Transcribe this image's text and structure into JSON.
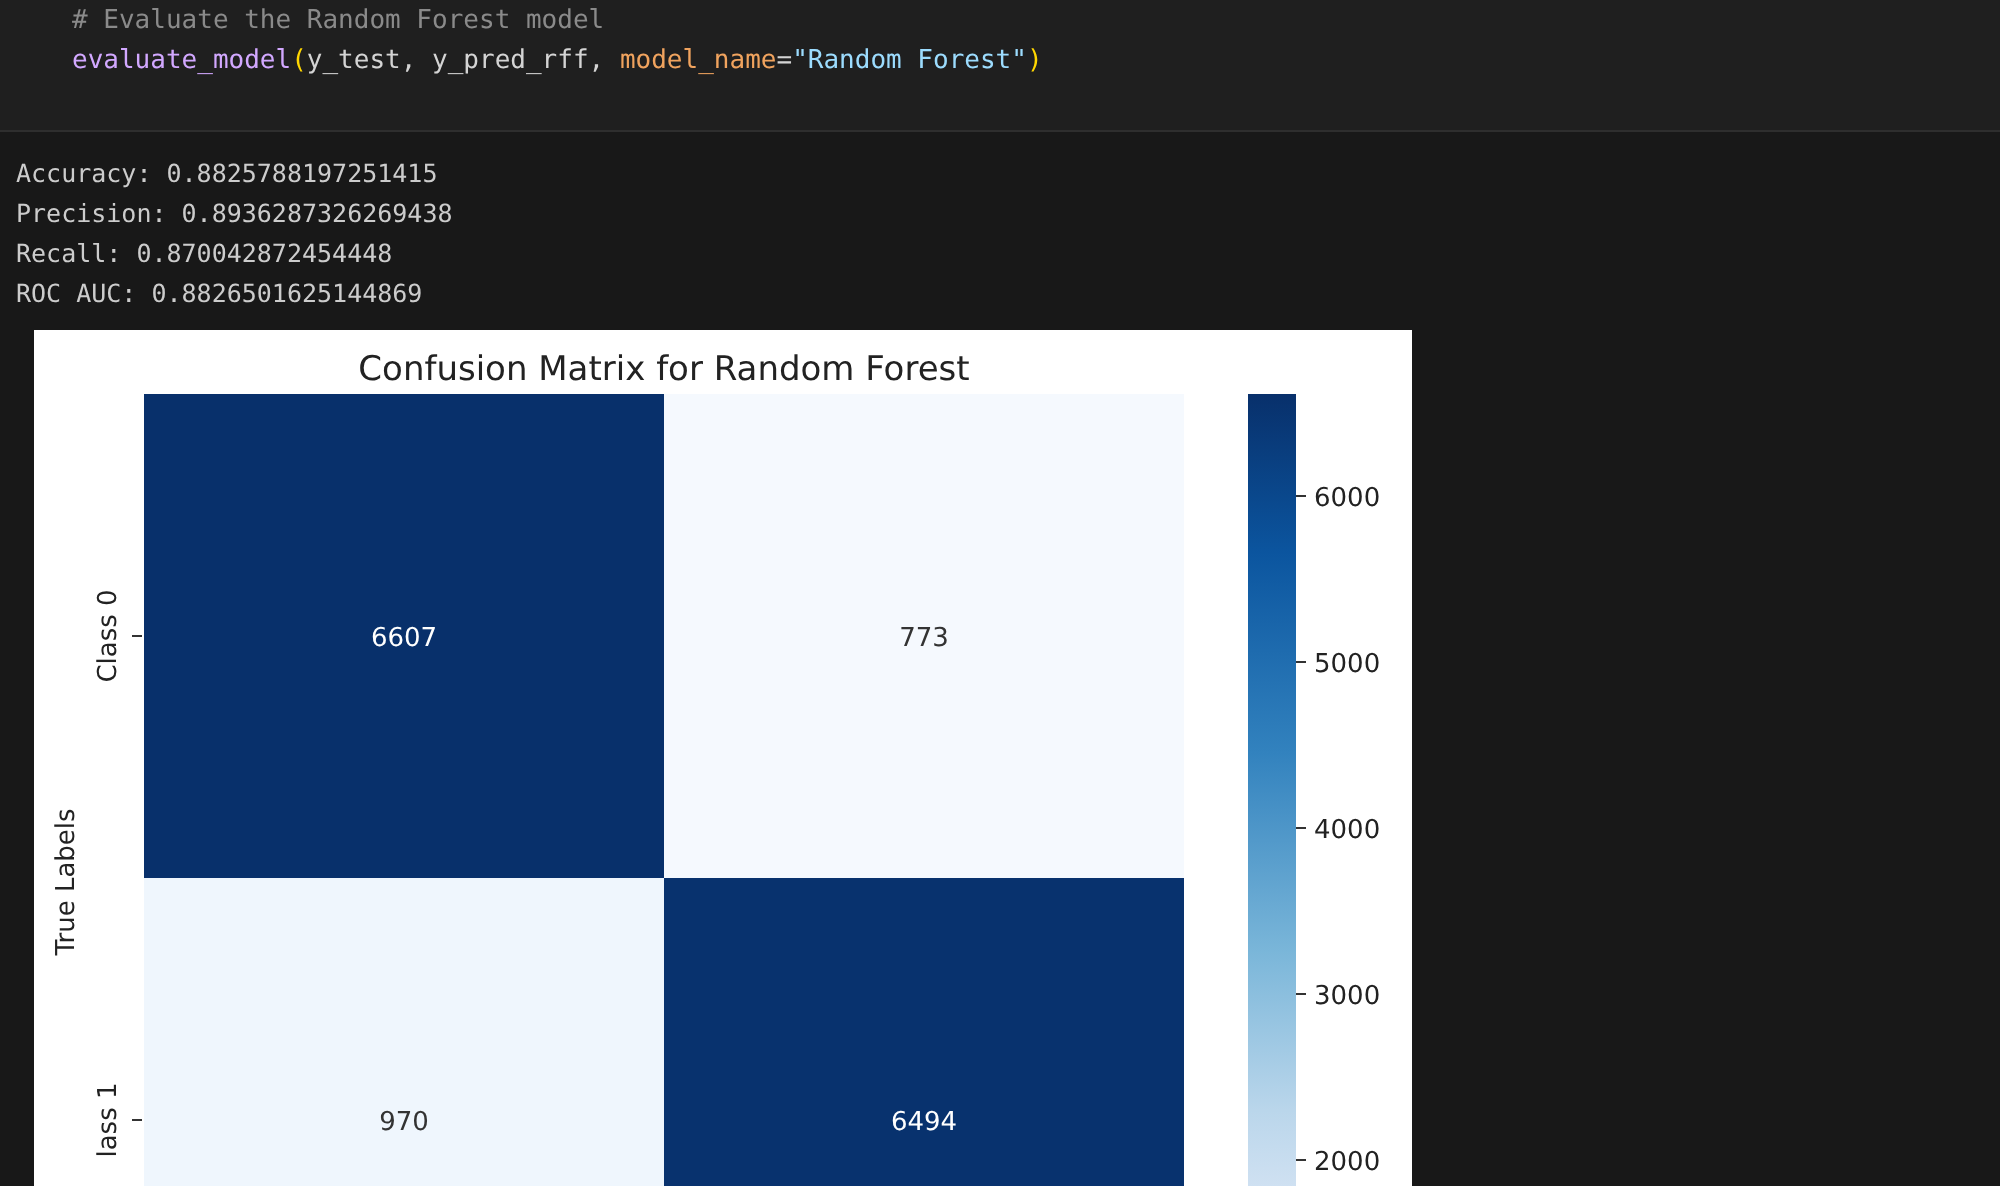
{
  "code_cell": {
    "lines": [
      [
        {
          "kind": "comment",
          "text": "# Evaluate the Random Forest model"
        }
      ],
      [
        {
          "kind": "function",
          "text": "evaluate_model"
        },
        {
          "kind": "bracket",
          "text": "("
        },
        {
          "kind": "plain",
          "text": "y_test, y_pred_rff, "
        },
        {
          "kind": "param",
          "text": "model_name"
        },
        {
          "kind": "plain",
          "text": "="
        },
        {
          "kind": "string",
          "text": "\"Random Forest\""
        },
        {
          "kind": "bracket",
          "text": ")"
        }
      ]
    ]
  },
  "output": {
    "lines": [
      "Accuracy: 0.8825788197251415",
      "Precision: 0.8936287326269438",
      "Recall: 0.870042872454448",
      "ROC AUC: 0.8826501625144869"
    ],
    "figure": {
      "title": "Confusion Matrix for Random Forest",
      "ylabel": "True Labels",
      "rows": [
        {
          "label": "Class 0",
          "cells": [
            {
              "value": "6607",
              "color": "#08306b"
            },
            {
              "value": "773",
              "color": "#f5f9fe"
            }
          ]
        },
        {
          "label": "lass 1",
          "cells": [
            {
              "value": "970",
              "color": "#eff6fd"
            },
            {
              "value": "6494",
              "color": "#08326e"
            }
          ]
        }
      ],
      "colorbar": {
        "ticks": [
          "6000",
          "5000",
          "4000",
          "3000",
          "2000"
        ]
      }
    }
  }
}
